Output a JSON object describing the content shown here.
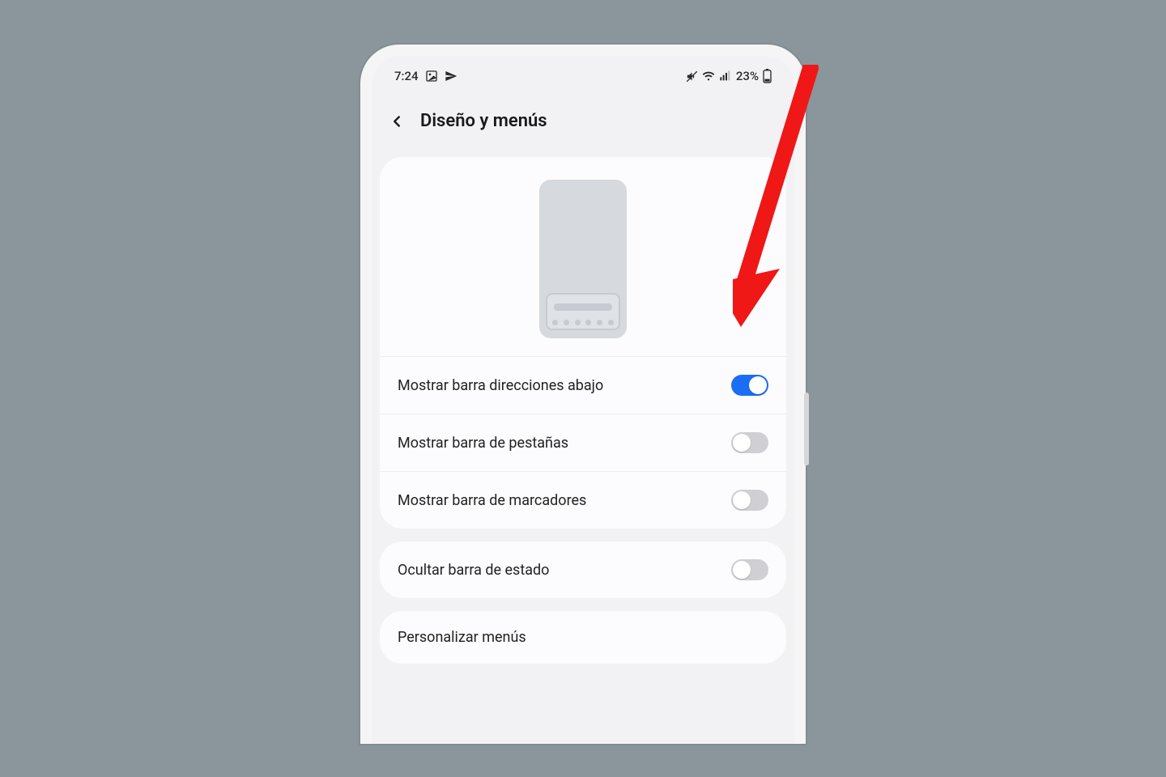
{
  "status_bar": {
    "time": "7:24",
    "battery_text": "23%"
  },
  "header": {
    "title": "Diseño y menús"
  },
  "settings": [
    {
      "label": "Mostrar barra direcciones abajo",
      "on": true
    },
    {
      "label": "Mostrar barra de pestañas",
      "on": false
    },
    {
      "label": "Mostrar barra de marcadores",
      "on": false
    }
  ],
  "extra_settings": [
    {
      "label": "Ocultar barra de estado",
      "on": false
    }
  ],
  "menu_row": {
    "label": "Personalizar menús"
  },
  "colors": {
    "accent": "#1b6ef3",
    "arrow": "#f01717"
  }
}
